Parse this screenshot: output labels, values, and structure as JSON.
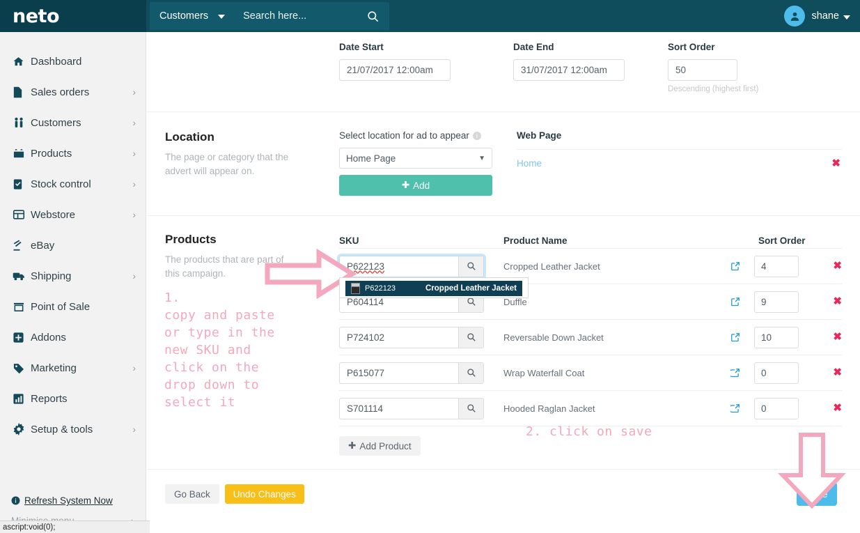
{
  "brand": {
    "logo_text": "neto",
    "accent_teal": "#0f4c5c",
    "accent_green": "#4ec0ab",
    "accent_blue": "#4dbcea",
    "accent_pink": "#f3a8bd",
    "accent_red": "#e8285a",
    "accent_yellow": "#f7bf17"
  },
  "topbar": {
    "scope_label": "Customers",
    "search_placeholder": "Search here...",
    "search_value": "",
    "user_name": "shane"
  },
  "sidebar": {
    "items": [
      {
        "label": "Dashboard",
        "icon": "home-icon",
        "has_chevron": false
      },
      {
        "label": "Sales orders",
        "icon": "document-icon",
        "has_chevron": true
      },
      {
        "label": "Customers",
        "icon": "people-icon",
        "has_chevron": true
      },
      {
        "label": "Products",
        "icon": "box-icon",
        "has_chevron": true
      },
      {
        "label": "Stock control",
        "icon": "clipboard-check-icon",
        "has_chevron": true
      },
      {
        "label": "Webstore",
        "icon": "window-icon",
        "has_chevron": true
      },
      {
        "label": "eBay",
        "icon": "gavel-icon",
        "has_chevron": false
      },
      {
        "label": "Shipping",
        "icon": "truck-icon",
        "has_chevron": true
      },
      {
        "label": "Point of Sale",
        "icon": "store-icon",
        "has_chevron": false
      },
      {
        "label": "Addons",
        "icon": "plus-square-icon",
        "has_chevron": false
      },
      {
        "label": "Marketing",
        "icon": "tag-icon",
        "has_chevron": true
      },
      {
        "label": "Reports",
        "icon": "bar-chart-icon",
        "has_chevron": false
      },
      {
        "label": "Setup & tools",
        "icon": "gear-icon",
        "has_chevron": true
      }
    ],
    "refresh_label": "Refresh System Now",
    "minimise_label": "Minimise menu"
  },
  "status_bar": {
    "text": "ascript:void(0);"
  },
  "schedule": {
    "date_start_label": "Date Start",
    "date_start_value": "21/07/2017 12:00am",
    "date_end_label": "Date End",
    "date_end_value": "31/07/2017 12:00am",
    "sort_order_label": "Sort Order",
    "sort_order_value": "50",
    "sort_order_helper": "Descending (highest first)"
  },
  "location": {
    "title": "Location",
    "description": "The page or category that the advert will appear on.",
    "select_label": "Select location for ad to appear",
    "select_value": "Home Page",
    "add_button": "Add",
    "webpage_header": "Web Page",
    "webpage_rows": [
      {
        "name": "Home"
      }
    ]
  },
  "products": {
    "title": "Products",
    "description": "The products that are part of this campaign.",
    "columns": {
      "sku": "SKU",
      "name": "Product Name",
      "sort": "Sort Order"
    },
    "rows": [
      {
        "sku": "P622123",
        "name": "Cropped Leather Jacket",
        "sort": "4",
        "focused": true
      },
      {
        "sku": "P604114",
        "name": "Duffle",
        "sort": "9",
        "focused": false
      },
      {
        "sku": "P724102",
        "name": "Reversable Down Jacket",
        "sort": "10",
        "focused": false
      },
      {
        "sku": "P615077",
        "name": "Wrap Waterfall Coat",
        "sort": "0",
        "focused": false
      },
      {
        "sku": "S701114",
        "name": "Hooded Raglan Jacket",
        "sort": "0",
        "focused": false
      }
    ],
    "autocomplete": {
      "visible": true,
      "items": [
        {
          "sku": "P622123",
          "name": "Cropped Leather Jacket"
        }
      ]
    },
    "add_product_button": "Add Product"
  },
  "footer": {
    "go_back": "Go Back",
    "undo_changes": "Undo Changes",
    "save": "Save"
  },
  "annotations": {
    "step1": "1.\ncopy and paste\nor type in the\nnew SKU and\nclick on the\ndrop down to\nselect it",
    "step2": "2. click on save"
  }
}
